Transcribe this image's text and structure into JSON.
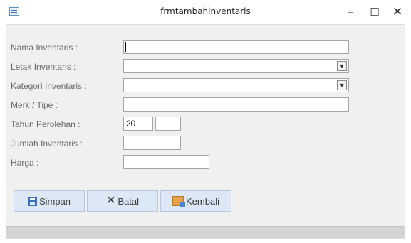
{
  "window": {
    "title": "frmtambahinventaris"
  },
  "labels": {
    "nama": "Nama Inventaris :",
    "letak": "Letak Inventaris :",
    "kategori": "Kategori Inventaris :",
    "merk": "Merk / Tipe :",
    "tahun": "Tahun Perolehan :",
    "jumlah": "Jumlah Inventaris :",
    "harga": "Harga :"
  },
  "fields": {
    "nama": "",
    "letak": "",
    "kategori": "",
    "merk": "",
    "tahun_prefix": "20",
    "tahun_suffix": "",
    "jumlah": "",
    "harga": ""
  },
  "buttons": {
    "simpan": "Simpan",
    "batal": "Batal",
    "kembali": "Kembali"
  },
  "icons": {
    "simpan": "save-icon",
    "batal": "cancel-icon",
    "kembali": "back-icon"
  }
}
